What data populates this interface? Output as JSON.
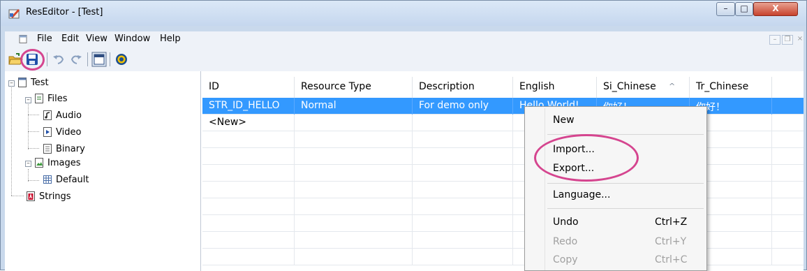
{
  "window": {
    "title": "ResEditor - [Test]"
  },
  "window_buttons": {
    "minimize": "–",
    "maximize": "□",
    "close": "X"
  },
  "menu": {
    "items": [
      "File",
      "Edit",
      "View",
      "Window",
      "Help"
    ]
  },
  "mdi_buttons": {
    "minimize": "–",
    "restore": "❐",
    "close": "×"
  },
  "toolbar": {
    "buttons": [
      "open-folder-icon",
      "save-icon",
      "undo-icon",
      "redo-icon",
      "view-icon",
      "help-icon"
    ]
  },
  "tree": {
    "root": "Test",
    "files": "Files",
    "audio": "Audio",
    "video": "Video",
    "binary": "Binary",
    "images": "Images",
    "default": "Default",
    "strings": "Strings"
  },
  "grid": {
    "columns": [
      "ID",
      "Resource Type",
      "Description",
      "English",
      "Si_Chinese",
      "Tr_Chinese"
    ],
    "sort_indicator": "^",
    "rows": [
      [
        "STR_ID_HELLO",
        "Normal",
        "For demo only",
        "Hello World!",
        "你好！",
        "你好！"
      ],
      [
        "<New>",
        "",
        "",
        "",
        "",
        ""
      ]
    ]
  },
  "context_menu": {
    "new": "New",
    "import": "Import...",
    "export": "Export...",
    "language": "Language...",
    "undo": "Undo",
    "undo_shortcut": "Ctrl+Z",
    "redo": "Redo",
    "redo_shortcut": "Ctrl+Y",
    "copy": "Copy",
    "copy_shortcut": "Ctrl+C"
  },
  "colors": {
    "selection": "#3399ff",
    "highlight_circle": "#d5458f"
  }
}
